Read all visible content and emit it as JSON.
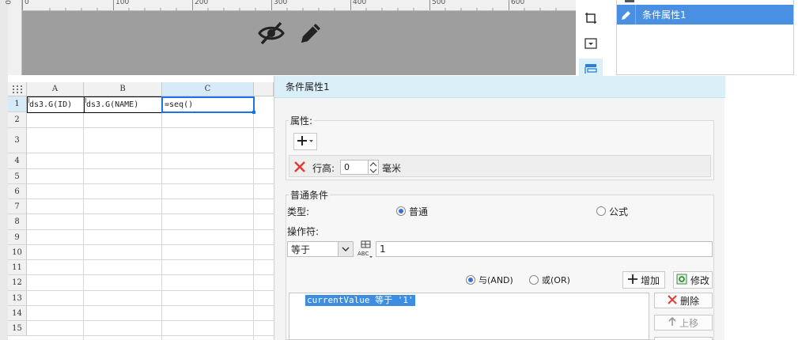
{
  "ruler": {
    "labels": [
      "0",
      "100",
      "200",
      "300",
      "400",
      "500",
      "600"
    ]
  },
  "vruler": {
    "zero": "0"
  },
  "design": {
    "hide_icon": "eye-slash-icon",
    "edit_icon": "pencil-icon"
  },
  "side_icons": [
    "crop-icon",
    "dropdown-box-icon",
    "conditional-format-icon"
  ],
  "condition_list": {
    "items": [
      {
        "label": "条件属性1",
        "icon": "pencil-icon"
      }
    ]
  },
  "sheet": {
    "columns": [
      "A",
      "B",
      "C"
    ],
    "rows": [
      "1",
      "2",
      "3",
      "4",
      "5",
      "6",
      "7",
      "8",
      "9",
      "10",
      "11",
      "12",
      "13",
      "14",
      "15"
    ],
    "cells": {
      "A1": "ds3.G(ID)",
      "B1": "ds3.G(NAME)",
      "C1": "=seq()"
    }
  },
  "dialog": {
    "title": "条件属性1",
    "attributes": {
      "label": "属性:",
      "add_icon": "plus-icon",
      "row_height_label": "行高:",
      "row_height_value": "0",
      "unit": "毫米"
    },
    "normal_condition": {
      "label": "普通条件",
      "type_label": "类型:",
      "type_normal": "普通",
      "type_formula": "公式",
      "operator_label": "操作符:",
      "operator_value": "等于",
      "operand_value": "1",
      "and_label": "与(AND)",
      "or_label": "或(OR)",
      "add_button": "增加",
      "modify_button": "修改",
      "delete_button": "删除",
      "move_up_button": "上移",
      "expression": "currentValue 等于 '1'"
    }
  },
  "colors": {
    "accent": "#4a90e2",
    "title_bar": "#dbeff9",
    "canvas": "#9e9e9e",
    "delete_red": "#e53935"
  }
}
